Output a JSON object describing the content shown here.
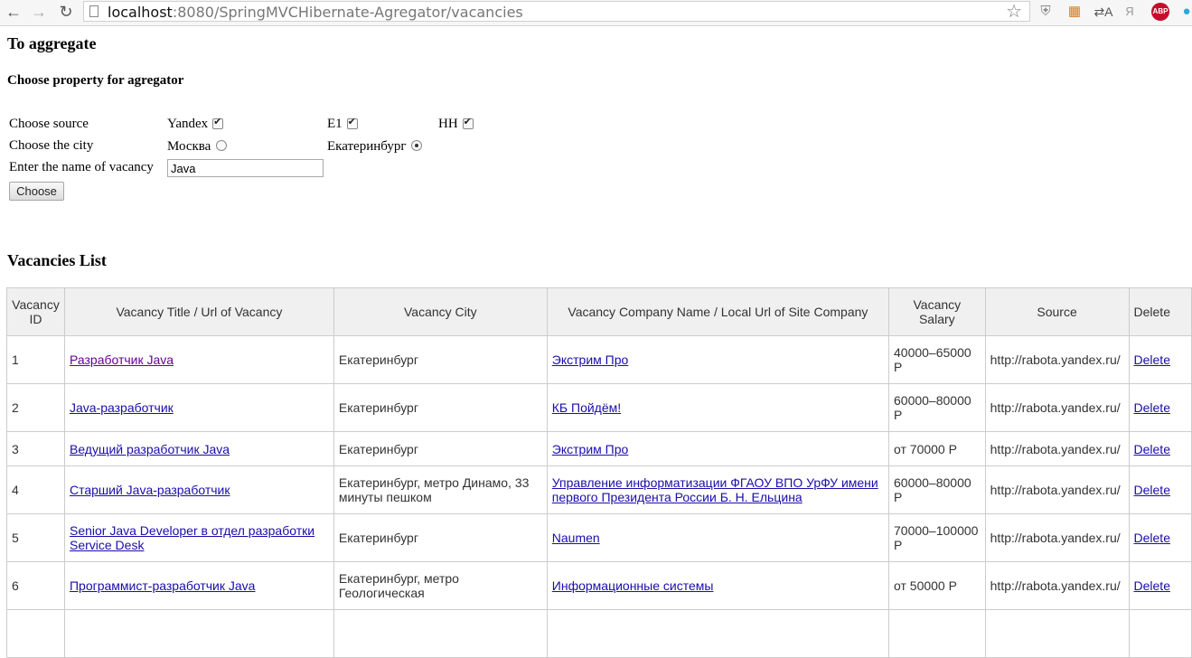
{
  "browser": {
    "url_host": "localhost",
    "url_path": ":8080/SpringMVCHibernate-Agregator/vacancies",
    "extensions": {
      "translate": "⇄A",
      "yandex": "Я",
      "adblock": "ABP"
    }
  },
  "page": {
    "title": "To aggregate",
    "subtitle": "Choose property for agregator",
    "form": {
      "source_label": "Choose source",
      "sources": [
        {
          "label": "Yandex",
          "checked": true
        },
        {
          "label": "E1",
          "checked": true
        },
        {
          "label": "HH",
          "checked": true
        }
      ],
      "city_label": "Choose the city",
      "cities": [
        {
          "label": "Москва",
          "checked": false
        },
        {
          "label": "Екатеринбург",
          "checked": true
        }
      ],
      "vacancy_label": "Enter the name of vacancy",
      "vacancy_value": "Java",
      "submit_label": "Choose"
    },
    "list_title": "Vacancies List"
  },
  "table": {
    "headers": [
      "Vacancy ID",
      "Vacancy Title / Url of Vacancy",
      "Vacancy City",
      "Vacancy Company Name / Local Url of Site Company",
      "Vacancy Salary",
      "Source",
      "Delete"
    ],
    "rows": [
      {
        "id": "1",
        "title": "Разработчик Java",
        "city": "Екатеринбург",
        "company": "Экстрим Про",
        "salary": "40000–65000 Р",
        "source": "http://rabota.yandex.ru/",
        "delete": "Delete"
      },
      {
        "id": "2",
        "title": "Java-разработчик",
        "city": "Екатеринбург",
        "company": "КБ Пойдём!",
        "salary": "60000–80000 Р",
        "source": "http://rabota.yandex.ru/",
        "delete": "Delete"
      },
      {
        "id": "3",
        "title": "Ведущий разработчик Java",
        "city": "Екатеринбург",
        "company": "Экстрим Про",
        "salary": "от 70000 Р",
        "source": "http://rabota.yandex.ru/",
        "delete": "Delete"
      },
      {
        "id": "4",
        "title": "Старший Java-разработчик",
        "city": "Екатеринбург, метро Динамо, 33 минуты пешком",
        "company": "Управление информатизации ФГАОУ ВПО УрФУ имени первого Президента России Б. Н. Ельцина",
        "salary": "60000–80000 Р",
        "source": "http://rabota.yandex.ru/",
        "delete": "Delete"
      },
      {
        "id": "5",
        "title": "Senior Java Developer в отдел разработки Service Desk",
        "city": "Екатеринбург",
        "company": "Naumen",
        "salary": "70000–100000 Р",
        "source": "http://rabota.yandex.ru/",
        "delete": "Delete"
      },
      {
        "id": "6",
        "title": "Программист-разработчик Java",
        "city": "Екатеринбург, метро Геологическая",
        "company": "Информационные системы",
        "salary": "от 50000 Р",
        "source": "http://rabota.yandex.ru/",
        "delete": "Delete"
      }
    ]
  }
}
